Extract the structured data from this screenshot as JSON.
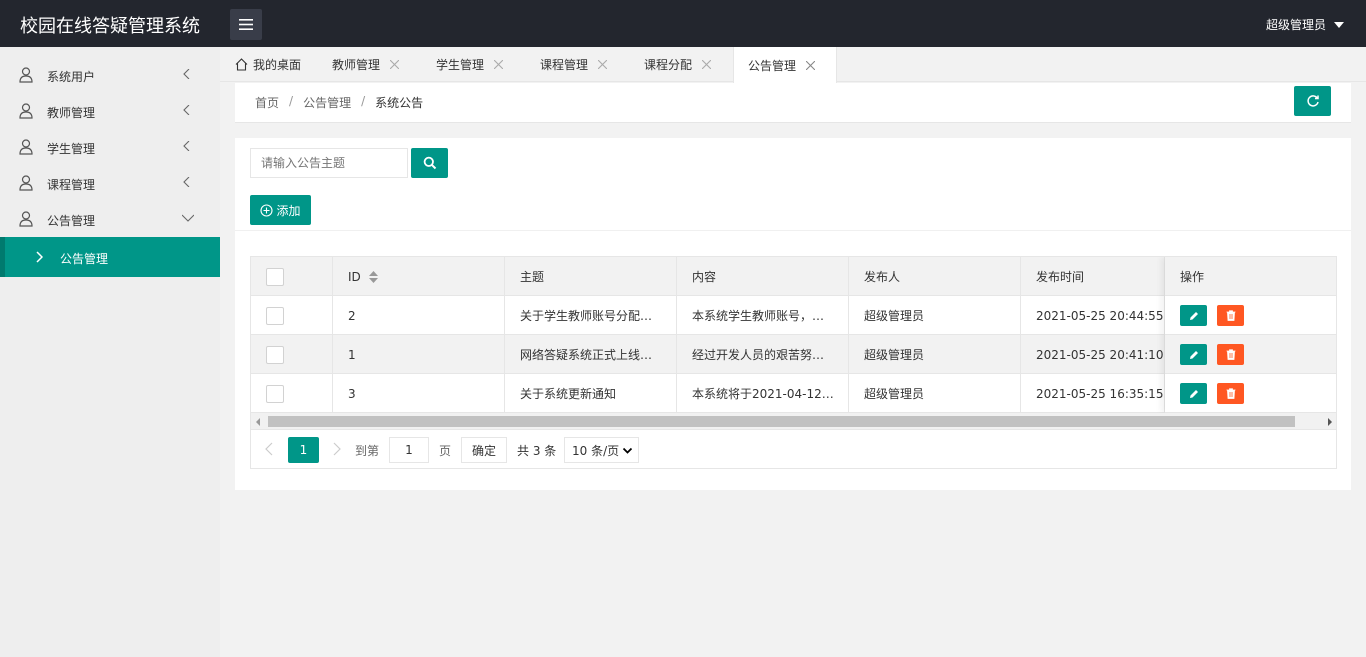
{
  "header": {
    "title": "校园在线答疑管理系统",
    "user": "超级管理员"
  },
  "sidebar": {
    "items": [
      {
        "label": "系统用户"
      },
      {
        "label": "教师管理"
      },
      {
        "label": "学生管理"
      },
      {
        "label": "课程管理"
      },
      {
        "label": "公告管理"
      }
    ],
    "sub_item": "公告管理"
  },
  "tabs": [
    {
      "label": "我的桌面"
    },
    {
      "label": "教师管理"
    },
    {
      "label": "学生管理"
    },
    {
      "label": "课程管理"
    },
    {
      "label": "课程分配"
    },
    {
      "label": "公告管理"
    }
  ],
  "breadcrumb": {
    "home": "首页",
    "section": "公告管理",
    "current": "系统公告"
  },
  "search": {
    "placeholder": "请输入公告主题",
    "value": ""
  },
  "toolbar": {
    "add_label": "添加"
  },
  "table": {
    "headers": [
      "ID",
      "主题",
      "内容",
      "发布人",
      "发布时间",
      "操作"
    ],
    "rows": [
      {
        "id": "2",
        "title": "关于学生教师账号分配…",
        "content": "本系统学生教师账号，…",
        "publisher": "超级管理员",
        "time": "2021-05-25 20:44:55"
      },
      {
        "id": "1",
        "title": "网络答疑系统正式上线…",
        "content": "经过开发人员的艰苦努…",
        "publisher": "超级管理员",
        "time": "2021-05-25 20:41:10"
      },
      {
        "id": "3",
        "title": "关于系统更新通知",
        "content": "本系统将于2021-04-12…",
        "publisher": "超级管理员",
        "time": "2021-05-25 16:35:15"
      }
    ]
  },
  "pager": {
    "current": "1",
    "goto_label": "到第",
    "input_value": "1",
    "page_label": "页",
    "ok_label": "确定",
    "total": "共 3 条",
    "size": "10 条/页"
  },
  "colors": {
    "primary": "#009688",
    "danger": "#ff5722",
    "header": "#23262e"
  }
}
